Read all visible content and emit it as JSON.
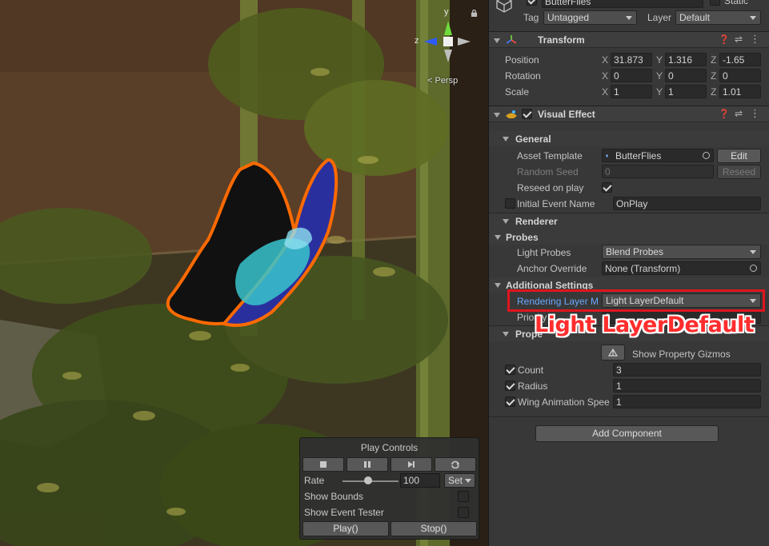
{
  "scene": {
    "persp_label": "< Persp",
    "gizmo": {
      "y": "y",
      "z": "z"
    }
  },
  "play_controls": {
    "title": "Play Controls",
    "rate_label": "Rate",
    "rate_value": "100",
    "set_label": "Set",
    "show_bounds": "Show Bounds",
    "show_event_tester": "Show Event Tester",
    "play_button": "Play()",
    "stop_button": "Stop()",
    "rate_slider_fraction": 0.45
  },
  "header": {
    "object_name": "ButterFlies",
    "static_label": "Static",
    "tag_label": "Tag",
    "tag_value": "Untagged",
    "layer_label": "Layer",
    "layer_value": "Default"
  },
  "transform": {
    "title": "Transform",
    "rows": [
      {
        "label": "Position",
        "x": "31.873",
        "y": "1.316",
        "z": "-1.65"
      },
      {
        "label": "Rotation",
        "x": "0",
        "y": "0",
        "z": "0"
      },
      {
        "label": "Scale",
        "x": "1",
        "y": "1",
        "z": "1.01"
      }
    ],
    "axes": [
      "X",
      "Y",
      "Z"
    ]
  },
  "visual_effect": {
    "title": "Visual Effect",
    "general": {
      "title": "General",
      "asset_template_label": "Asset Template",
      "asset_template_value": "ButterFlies",
      "edit_button": "Edit",
      "random_seed_label": "Random Seed",
      "random_seed_value": "0",
      "reseed_button": "Reseed",
      "reseed_on_play_label": "Reseed on play",
      "initial_event_label": "Initial Event Name",
      "initial_event_value": "OnPlay"
    },
    "renderer_title": "Renderer",
    "probes": {
      "title": "Probes",
      "light_probes_label": "Light Probes",
      "light_probes_value": "Blend Probes",
      "anchor_override_label": "Anchor Override",
      "anchor_override_value": "None (Transform)"
    },
    "additional": {
      "title": "Additional Settings",
      "rendering_layer_label": "Rendering Layer M",
      "rendering_layer_value": "Light LayerDefault",
      "priority_label": "Priority",
      "priority_value": "0"
    },
    "properties": {
      "title": "Prope",
      "gizmo_button": "Show Property Gizmos",
      "items": [
        {
          "label": "Count",
          "value": "3"
        },
        {
          "label": "Radius",
          "value": "1"
        },
        {
          "label": "Wing Animation Spee",
          "value": "1"
        }
      ]
    }
  },
  "add_component_button": "Add Component",
  "annotation": {
    "text": "Light LayerDefault",
    "color": "#ff2d2d"
  },
  "colors": {
    "inspector_bg": "#383838",
    "highlight_border": "#e0141e",
    "link_blue": "#6aa8ff"
  }
}
